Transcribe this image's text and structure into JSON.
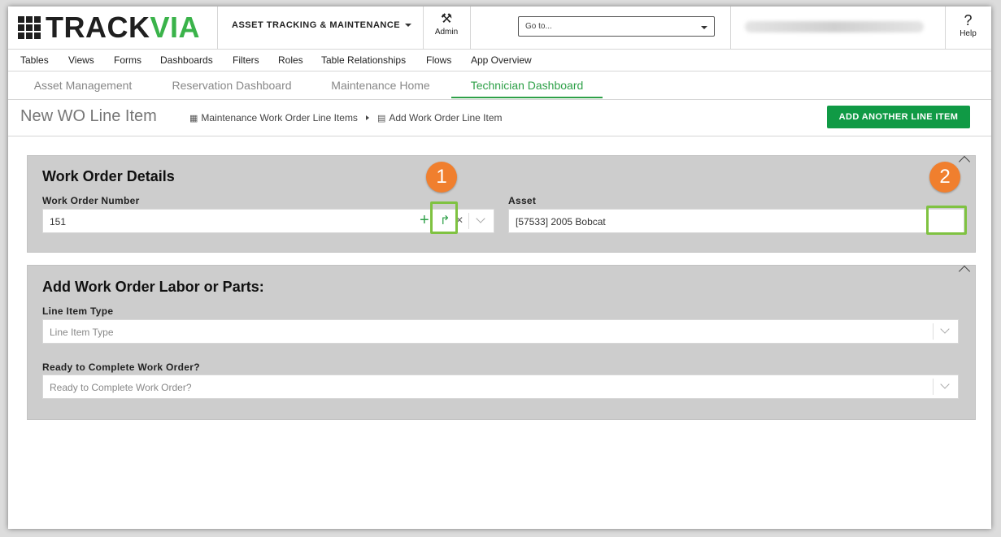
{
  "header": {
    "logo_part1": "TRACK",
    "logo_part2": "VIA",
    "app_name": "ASSET TRACKING & MAINTENANCE",
    "admin_label": "Admin",
    "goto_placeholder": "Go to...",
    "help_symbol": "?",
    "help_label": "Help"
  },
  "admin_menu": [
    "Tables",
    "Views",
    "Forms",
    "Dashboards",
    "Filters",
    "Roles",
    "Table Relationships",
    "Flows",
    "App Overview"
  ],
  "tabs": [
    {
      "label": "Asset Management"
    },
    {
      "label": "Reservation Dashboard"
    },
    {
      "label": "Maintenance Home"
    },
    {
      "label": "Technician Dashboard",
      "active": true
    }
  ],
  "page": {
    "title": "New WO Line Item",
    "breadcrumb1": "Maintenance Work Order Line Items",
    "breadcrumb2": "Add Work Order Line Item",
    "primary_button": "ADD ANOTHER LINE ITEM"
  },
  "section1": {
    "title": "Work Order Details",
    "wo_label": "Work Order Number",
    "wo_value": "151",
    "asset_label": "Asset",
    "asset_value": "[57533] 2005 Bobcat"
  },
  "section2": {
    "title": "Add Work Order Labor or Parts:",
    "type_label": "Line Item Type",
    "type_placeholder": "Line Item Type",
    "ready_label": "Ready to Complete Work Order?",
    "ready_placeholder": "Ready to Complete Work Order?"
  },
  "callouts": {
    "one": "1",
    "two": "2"
  },
  "colors": {
    "accent": "#2ea048",
    "button": "#109a45",
    "callout": "#f07f2e",
    "highlight": "#7fc241"
  }
}
